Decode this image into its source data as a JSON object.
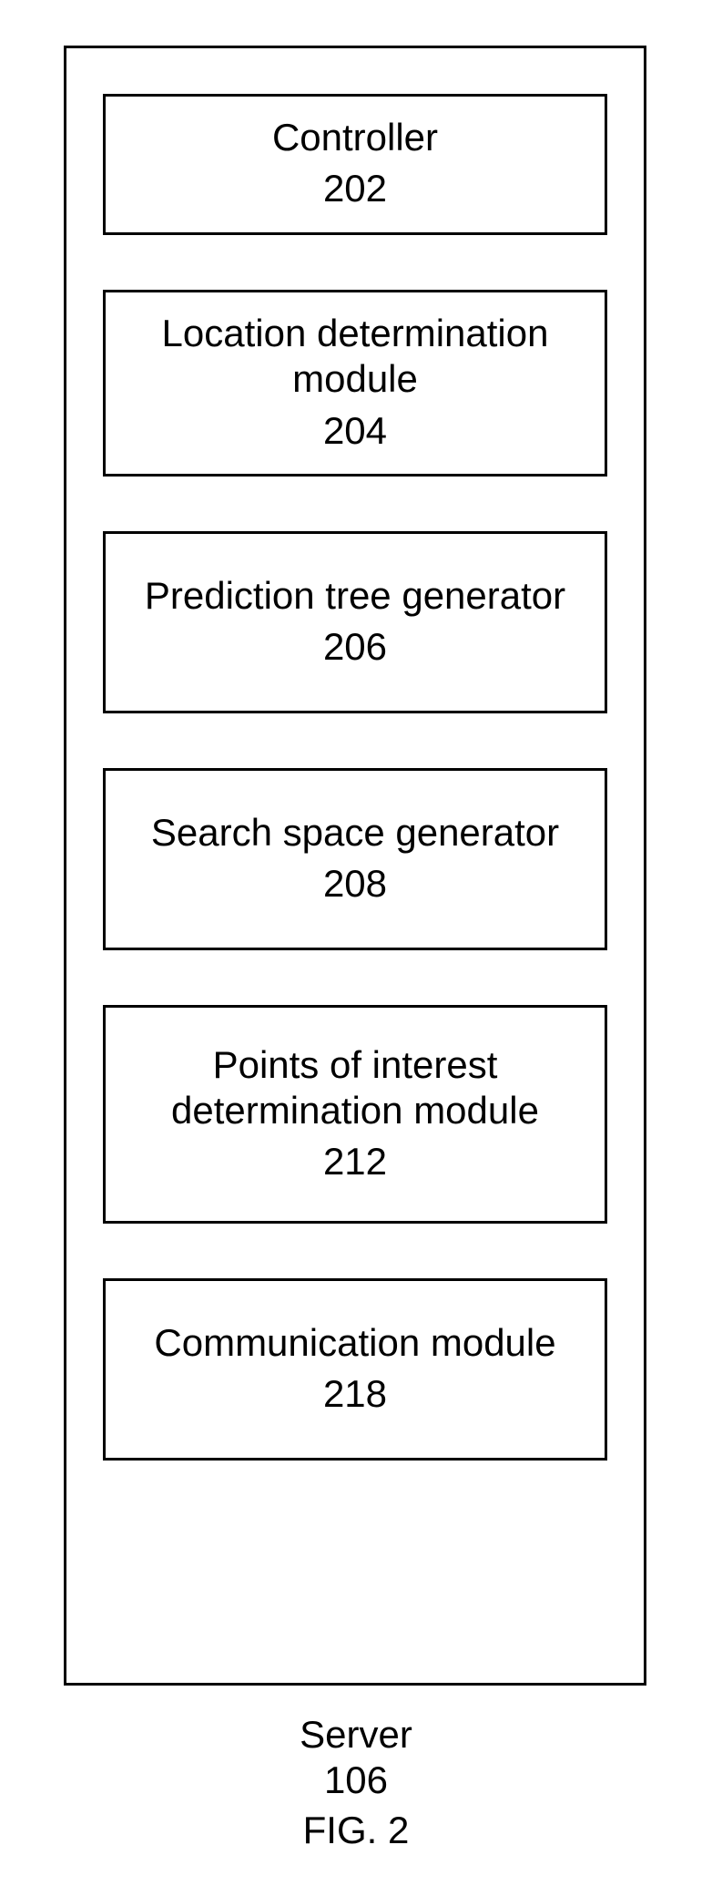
{
  "modules": [
    {
      "title": "Controller",
      "number": "202",
      "size": "small"
    },
    {
      "title": "Location determination module",
      "number": "204",
      "size": "medium"
    },
    {
      "title": "Prediction tree generator",
      "number": "206",
      "size": "medium"
    },
    {
      "title": "Search space generator",
      "number": "208",
      "size": "medium"
    },
    {
      "title": "Points of interest determination module",
      "number": "212",
      "size": "large"
    },
    {
      "title": "Communication module",
      "number": "218",
      "size": "medium"
    }
  ],
  "server": {
    "title": "Server",
    "number": "106"
  },
  "figure": "FIG. 2"
}
